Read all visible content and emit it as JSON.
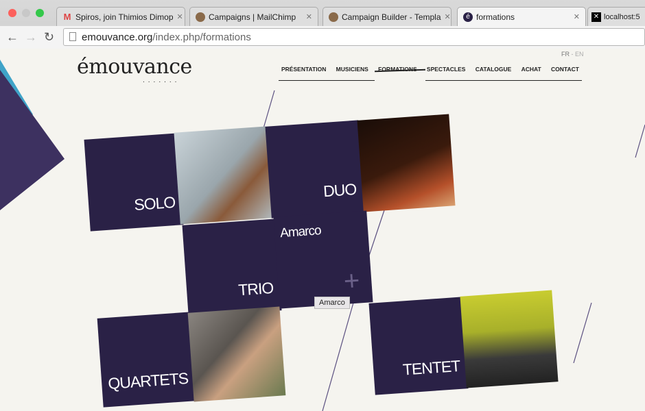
{
  "browser": {
    "tabs": [
      {
        "title": "Spiros, join Thimios Dimop",
        "icon": "gmail-icon"
      },
      {
        "title": "Campaigns | MailChimp",
        "icon": "mailchimp-icon"
      },
      {
        "title": "Campaign Builder - Templa",
        "icon": "mailchimp-icon"
      },
      {
        "title": "formations",
        "icon": "emouvance-icon",
        "active": true
      },
      {
        "title": "localhost:5",
        "icon": "x-icon"
      }
    ],
    "url_host": "emouvance.org",
    "url_path": "/index.php/formations"
  },
  "site": {
    "logo": "émouvance",
    "lang": {
      "fr": "FR",
      "sep": " - ",
      "en": "EN"
    },
    "menu": [
      "PRÉSENTATION",
      "MUSICIENS",
      "FORMATIONS",
      "SPECTACLES",
      "CATALOGUE",
      "ACHAT",
      "CONTACT"
    ],
    "active_menu": "FORMATIONS"
  },
  "tiles": {
    "solo": "SOLO",
    "duo": "DUO",
    "trio": "TRIO",
    "amarco": "Amarco",
    "quartets": "QUARTETS",
    "tentet": "TENTET"
  },
  "tooltip": "Amarco",
  "colors": {
    "tile": "#2a2146",
    "background": "#f5f4ef",
    "accent_triangle": "#3fa3c8"
  }
}
